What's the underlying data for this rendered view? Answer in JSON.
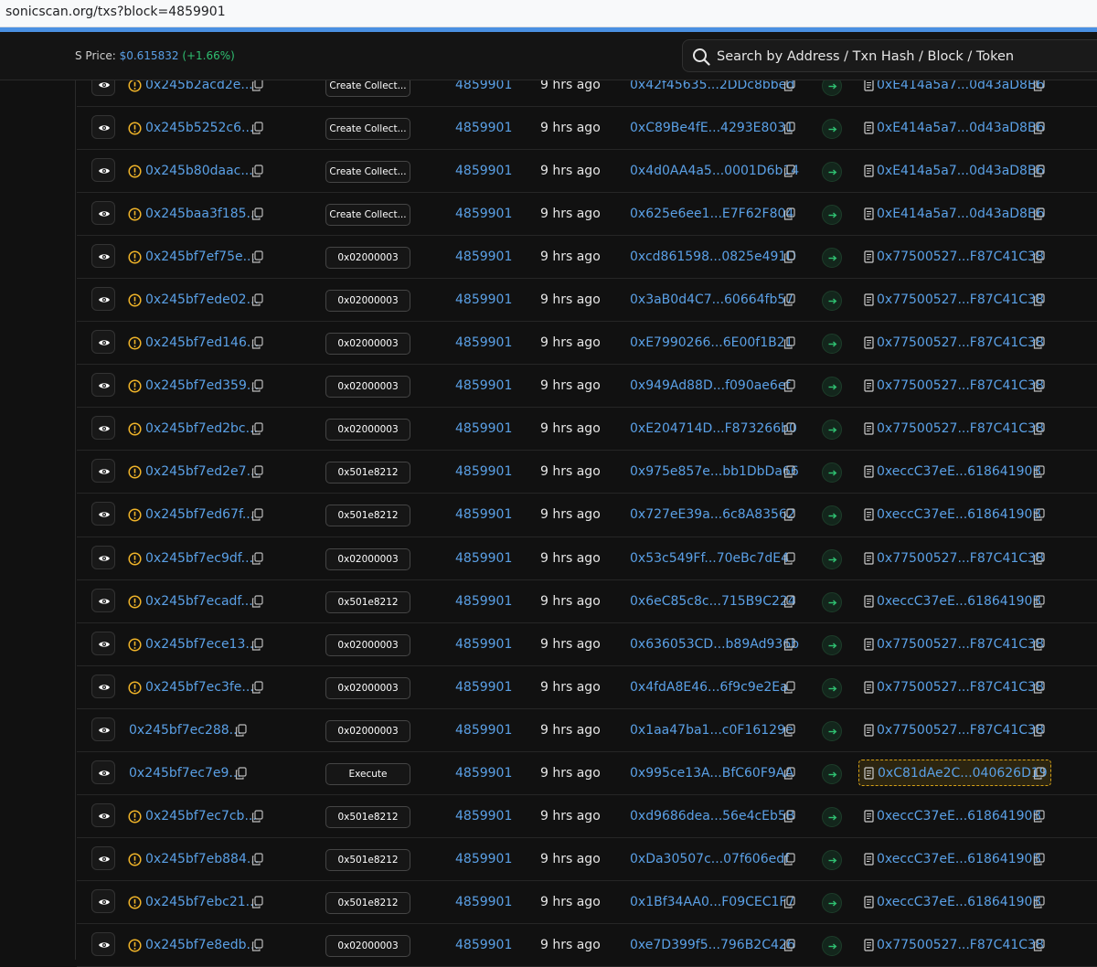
{
  "browser": {
    "url": "sonicscan.org/txs?block=4859901"
  },
  "header": {
    "price_label": "S Price:",
    "price_value": "$0.615832",
    "price_change": "(+1.66%)",
    "search_placeholder": "Search by Address / Txn Hash / Block / Token"
  },
  "rows": [
    {
      "hash": "0x245b2acd2e...",
      "warn": true,
      "method": "Create Collect...",
      "block": "4859901",
      "age": "9 hrs ago",
      "from": "0x42f45635...2DDc8bbed",
      "to": "0xE414a5a7...0d43aD8B6",
      "highlight": false
    },
    {
      "hash": "0x245b5252c6...",
      "warn": true,
      "method": "Create Collect...",
      "block": "4859901",
      "age": "9 hrs ago",
      "from": "0xC89Be4fE...4293E8031",
      "to": "0xE414a5a7...0d43aD8B6",
      "highlight": false
    },
    {
      "hash": "0x245b80daac...",
      "warn": true,
      "method": "Create Collect...",
      "block": "4859901",
      "age": "9 hrs ago",
      "from": "0x4d0AA4a5...0001D6b14",
      "to": "0xE414a5a7...0d43aD8B6",
      "highlight": false
    },
    {
      "hash": "0x245baa3f185...",
      "warn": true,
      "method": "Create Collect...",
      "block": "4859901",
      "age": "9 hrs ago",
      "from": "0x625e6ee1...E7F62F804",
      "to": "0xE414a5a7...0d43aD8B6",
      "highlight": false
    },
    {
      "hash": "0x245bf7ef75e...",
      "warn": true,
      "method": "0x02000003",
      "block": "4859901",
      "age": "9 hrs ago",
      "from": "0xcd861598...0825e491D",
      "to": "0x77500527...F87C41C38",
      "highlight": false
    },
    {
      "hash": "0x245bf7ede02...",
      "warn": true,
      "method": "0x02000003",
      "block": "4859901",
      "age": "9 hrs ago",
      "from": "0x3aB0d4C7...60664fb57",
      "to": "0x77500527...F87C41C38",
      "highlight": false
    },
    {
      "hash": "0x245bf7ed146...",
      "warn": true,
      "method": "0x02000003",
      "block": "4859901",
      "age": "9 hrs ago",
      "from": "0xE7990266...6E00f1B21",
      "to": "0x77500527...F87C41C38",
      "highlight": false
    },
    {
      "hash": "0x245bf7ed359...",
      "warn": true,
      "method": "0x02000003",
      "block": "4859901",
      "age": "9 hrs ago",
      "from": "0x949Ad88D...f090ae6ef",
      "to": "0x77500527...F87C41C38",
      "highlight": false
    },
    {
      "hash": "0x245bf7ed2bc...",
      "warn": true,
      "method": "0x02000003",
      "block": "4859901",
      "age": "9 hrs ago",
      "from": "0xE204714D...F873266b0",
      "to": "0x77500527...F87C41C38",
      "highlight": false
    },
    {
      "hash": "0x245bf7ed2e7...",
      "warn": true,
      "method": "0x501e8212",
      "block": "4859901",
      "age": "9 hrs ago",
      "from": "0x975e857e...bb1DbDa66",
      "to": "0xeccC37eE...61864190B",
      "highlight": false
    },
    {
      "hash": "0x245bf7ed67f...",
      "warn": true,
      "method": "0x501e8212",
      "block": "4859901",
      "age": "9 hrs ago",
      "from": "0x727eE39a...6c8A83562",
      "to": "0xeccC37eE...61864190B",
      "highlight": false
    },
    {
      "hash": "0x245bf7ec9df...",
      "warn": true,
      "method": "0x02000003",
      "block": "4859901",
      "age": "9 hrs ago",
      "from": "0x53c549Ff...70eBc7dE4",
      "to": "0x77500527...F87C41C38",
      "highlight": false
    },
    {
      "hash": "0x245bf7ecadf...",
      "warn": true,
      "method": "0x501e8212",
      "block": "4859901",
      "age": "9 hrs ago",
      "from": "0x6eC85c8c...715B9C224",
      "to": "0xeccC37eE...61864190B",
      "highlight": false
    },
    {
      "hash": "0x245bf7ece13...",
      "warn": true,
      "method": "0x02000003",
      "block": "4859901",
      "age": "9 hrs ago",
      "from": "0x636053CD...b89Ad936b",
      "to": "0x77500527...F87C41C38",
      "highlight": false
    },
    {
      "hash": "0x245bf7ec3fe...",
      "warn": true,
      "method": "0x02000003",
      "block": "4859901",
      "age": "9 hrs ago",
      "from": "0x4fdA8E46...6f9c9e2Ea",
      "to": "0x77500527...F87C41C38",
      "highlight": false
    },
    {
      "hash": "0x245bf7ec288...",
      "warn": false,
      "method": "0x02000003",
      "block": "4859901",
      "age": "9 hrs ago",
      "from": "0x1aa47ba1...c0F16129e",
      "to": "0x77500527...F87C41C38",
      "highlight": false
    },
    {
      "hash": "0x245bf7ec7e9...",
      "warn": false,
      "method": "Execute",
      "block": "4859901",
      "age": "9 hrs ago",
      "from": "0x995ce13A...BfC60F9AA",
      "to": "0xC81dAe2C...040626D19",
      "highlight": true
    },
    {
      "hash": "0x245bf7ec7cb...",
      "warn": true,
      "method": "0x501e8212",
      "block": "4859901",
      "age": "9 hrs ago",
      "from": "0xd9686dea...56e4cEb5B",
      "to": "0xeccC37eE...61864190B",
      "highlight": false
    },
    {
      "hash": "0x245bf7eb884...",
      "warn": true,
      "method": "0x501e8212",
      "block": "4859901",
      "age": "9 hrs ago",
      "from": "0xDa30507c...07f606edf",
      "to": "0xeccC37eE...61864190B",
      "highlight": false
    },
    {
      "hash": "0x245bf7ebc21...",
      "warn": true,
      "method": "0x501e8212",
      "block": "4859901",
      "age": "9 hrs ago",
      "from": "0x1Bf34AA0...F09CEC1F7",
      "to": "0xeccC37eE...61864190B",
      "highlight": false
    },
    {
      "hash": "0x245bf7e8edb...",
      "warn": true,
      "method": "0x02000003",
      "block": "4859901",
      "age": "9 hrs ago",
      "from": "0xe7D399f5...796B2C426",
      "to": "0x77500527...F87C41C38",
      "highlight": false
    }
  ],
  "icons": {
    "warning": "warning-circle-icon",
    "eye": "eye-icon",
    "copy": "copy-icon",
    "arrow": "arrow-right-icon",
    "contract": "contract-document-icon"
  },
  "colors": {
    "link": "#5aa0e6",
    "warning": "#f0b429",
    "positive": "#2fbf71",
    "background": "#111111"
  }
}
